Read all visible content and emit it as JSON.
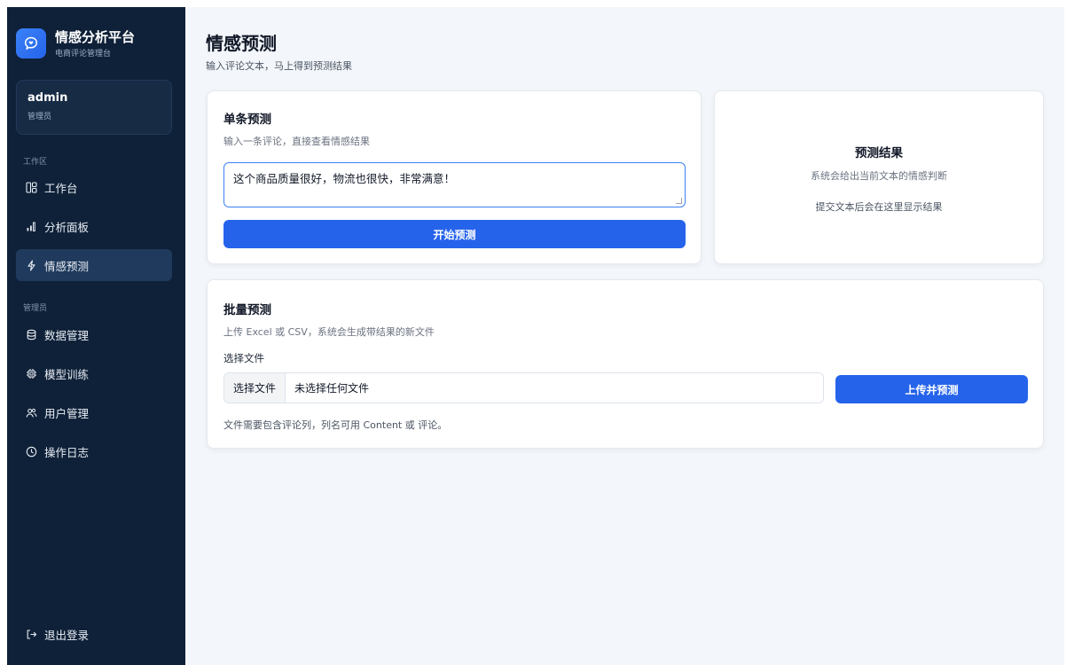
{
  "brand": {
    "title": "情感分析平台",
    "subtitle": "电商评论管理台",
    "icon": "chat-heart-icon",
    "accent": "#2563eb"
  },
  "user": {
    "name": "admin",
    "role": "管理员"
  },
  "sidebar": {
    "sections": [
      {
        "label": "工作区",
        "items": [
          {
            "label": "工作台",
            "icon": "dashboard-icon",
            "active": false
          },
          {
            "label": "分析面板",
            "icon": "bar-chart-icon",
            "active": false
          },
          {
            "label": "情感预测",
            "icon": "lightning-icon",
            "active": true
          }
        ]
      },
      {
        "label": "管理员",
        "items": [
          {
            "label": "数据管理",
            "icon": "database-icon",
            "active": false
          },
          {
            "label": "模型训练",
            "icon": "chip-icon",
            "active": false
          },
          {
            "label": "用户管理",
            "icon": "users-icon",
            "active": false
          },
          {
            "label": "操作日志",
            "icon": "clock-icon",
            "active": false
          }
        ]
      }
    ],
    "logout": {
      "label": "退出登录",
      "icon": "logout-icon"
    }
  },
  "page": {
    "title": "情感预测",
    "subtitle": "输入评论文本，马上得到预测结果"
  },
  "single": {
    "title": "单条预测",
    "subtitle": "输入一条评论，直接查看情感结果",
    "input_value": "这个商品质量很好，物流也很快，非常满意！",
    "submit_label": "开始预测"
  },
  "result": {
    "title": "预测结果",
    "subtitle": "系统会给出当前文本的情感判断",
    "hint": "提交文本后会在这里显示结果"
  },
  "batch": {
    "title": "批量预测",
    "subtitle": "上传 Excel 或 CSV，系统会生成带结果的新文件",
    "file_label": "选择文件",
    "file_button": "选择文件",
    "file_status": "未选择任何文件",
    "submit_label": "上传并预测",
    "hint": "文件需要包含评论列，列名可用 Content 或 评论。"
  }
}
